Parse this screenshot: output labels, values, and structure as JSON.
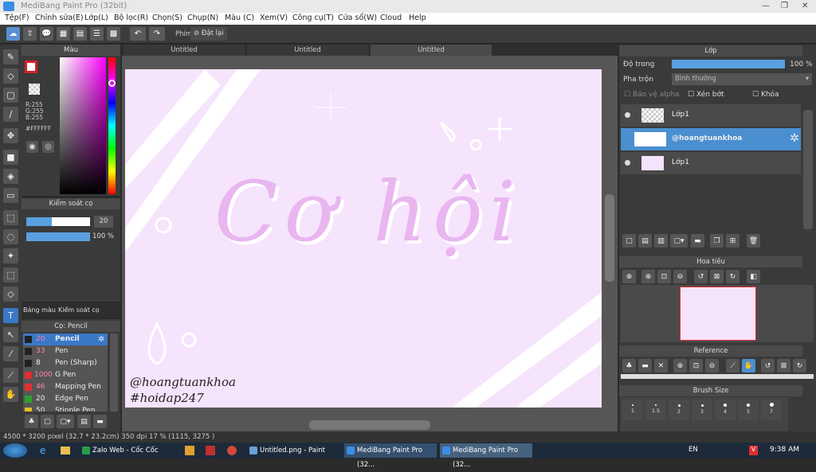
{
  "window": {
    "title": "MediBang Paint Pro (32bit)"
  },
  "menu": [
    "Tệp(F)",
    "Chỉnh sửa(E)",
    "Lớp(L)",
    "Bộ lọc(R)",
    "Chọn(S)",
    "Chụp(N)",
    "Màu (C)",
    "Xem(V)",
    "Công cụ(T)",
    "Cửa sổ(W)",
    "Cloud",
    "Help"
  ],
  "toolbar": {
    "phim_label": "Phím",
    "reset_label": "Đặt lại"
  },
  "color_panel": {
    "title": "Màu",
    "r": "R:255",
    "g": "G:255",
    "b": "B:255",
    "hex": "#FFFFFF",
    "current_color": "#d4202a",
    "hue_marker": "#ff00ff"
  },
  "brush_control": {
    "title": "Kiểm soát cọ",
    "size": "20",
    "opacity": "100 %",
    "size_fill": 0.4,
    "opacity_fill": 1.0
  },
  "left_tabs": {
    "palette": "Bảng màu",
    "brush_ctrl": "Kiểm soát cọ"
  },
  "brush_list": {
    "title": "Cọ: Pencil",
    "items": [
      {
        "size": "20",
        "name": "Pencil",
        "color": "#222222"
      },
      {
        "size": "33",
        "name": "Pen",
        "color": "#222222"
      },
      {
        "size": "8",
        "name": "Pen (Sharp)",
        "color": "#222222"
      },
      {
        "size": "1000",
        "name": "G Pen",
        "color": "#e03030"
      },
      {
        "size": "46",
        "name": "Mapping Pen",
        "color": "#e03030"
      },
      {
        "size": "20",
        "name": "Edge Pen",
        "color": "#2ea02e"
      },
      {
        "size": "50",
        "name": "Stipple Pen",
        "color": "#e0c020"
      }
    ]
  },
  "tabs": [
    "Untitled",
    "Untitled",
    "Untitled"
  ],
  "canvas": {
    "main_text": "Cơ hội",
    "sig1": "@hoangtuankhoa",
    "sig2": "#hoidap247",
    "bg": "#f6e3fc",
    "lettering": "#e9b6f0"
  },
  "layers_panel": {
    "title": "Lớp",
    "opacity_label": "Độ trong",
    "opacity_value": "100 %",
    "blend_label": "Pha trộn",
    "blend_value": "Bình thường",
    "protect_alpha": "Bảo vệ alpha",
    "clipping": "Xén bớt",
    "lock": "Khóa",
    "layers": [
      {
        "name": "Lớp1"
      },
      {
        "name": "@hoangtuankhoa"
      },
      {
        "name": "Lớp1"
      }
    ]
  },
  "navigator": {
    "title": "Hoa tiêu"
  },
  "reference": {
    "title": "Reference"
  },
  "brush_size": {
    "title": "Brush Size",
    "values": [
      "1",
      "1.5",
      "2",
      "3",
      "4",
      "5",
      "7"
    ]
  },
  "status": "4500 * 3200 pixel  (32.7 * 23.2cm)  350 dpi  17 %  (1115, 3275 )",
  "taskbar": {
    "items": [
      "Zalo Web - Cốc Cốc",
      "Untitled.png - Paint",
      "MediBang Paint Pro (32...",
      "MediBang Paint Pro (32..."
    ],
    "lang": "EN",
    "time": "9:38 AM"
  }
}
